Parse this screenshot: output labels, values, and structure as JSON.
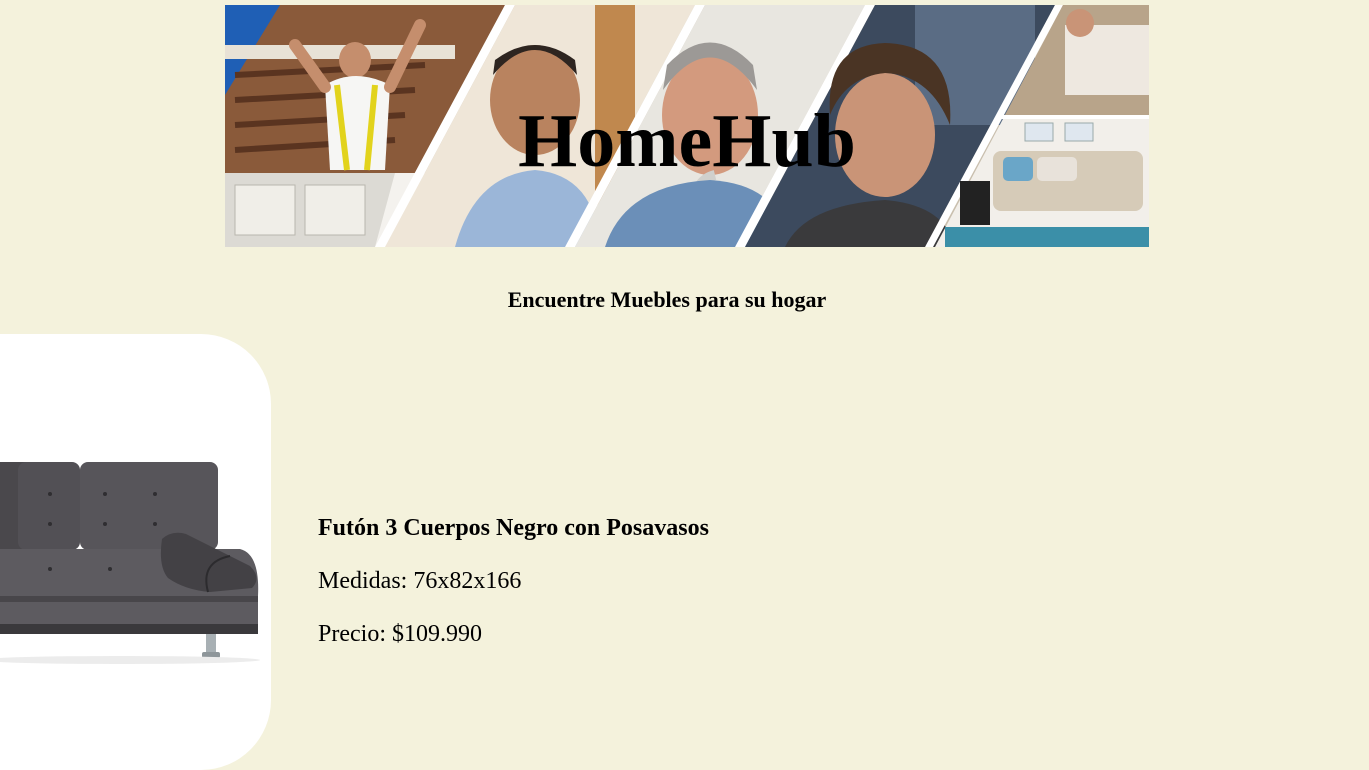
{
  "header": {
    "site_title": "HomeHub",
    "banner_image": "home-improvement-collage"
  },
  "main": {
    "subtitle": "Encuentre Muebles para su hogar"
  },
  "product": {
    "image": "black-futon-sofa",
    "name": "Futón 3 Cuerpos Negro con Posavasos",
    "measures_label": "Medidas:",
    "measures_value": "76x82x166",
    "price_label": "Precio:",
    "price_value": "$109.990"
  },
  "colors": {
    "page_background": "#f4f2dc",
    "card_background": "#ffffff",
    "text": "#000000"
  }
}
